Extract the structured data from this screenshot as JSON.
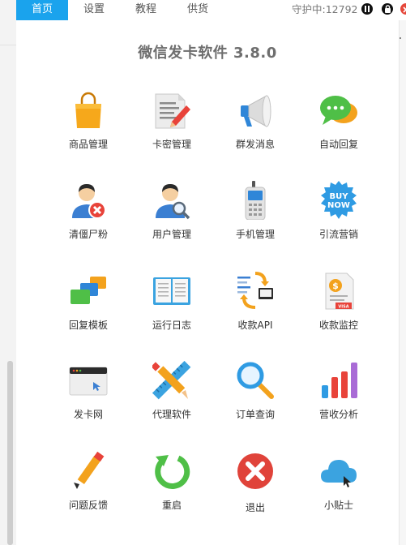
{
  "tabs": [
    {
      "label": "首页",
      "active": true
    },
    {
      "label": "设置",
      "active": false
    },
    {
      "label": "教程",
      "active": false
    },
    {
      "label": "供货",
      "active": false
    }
  ],
  "status_text": "守护中:12792",
  "title": "微信发卡软件 3.8.0",
  "colors": {
    "accent": "#1aa3ed",
    "close": "#e5473a"
  },
  "menu": [
    {
      "label": "商品管理",
      "icon": "shopping-bag-icon"
    },
    {
      "label": "卡密管理",
      "icon": "document-pen-icon"
    },
    {
      "label": "群发消息",
      "icon": "megaphone-icon"
    },
    {
      "label": "自动回复",
      "icon": "chat-bubble-icon"
    },
    {
      "label": "清僵尸粉",
      "icon": "remove-user-icon"
    },
    {
      "label": "用户管理",
      "icon": "user-search-icon"
    },
    {
      "label": "手机管理",
      "icon": "phone-icon"
    },
    {
      "label": "引流营销",
      "icon": "buy-now-badge-icon"
    },
    {
      "label": "回复模板",
      "icon": "template-cards-icon"
    },
    {
      "label": "运行日志",
      "icon": "open-book-icon"
    },
    {
      "label": "收款API",
      "icon": "api-sync-icon"
    },
    {
      "label": "收款监控",
      "icon": "invoice-icon"
    },
    {
      "label": "发卡网",
      "icon": "browser-window-icon"
    },
    {
      "label": "代理软件",
      "icon": "pencil-ruler-icon"
    },
    {
      "label": "订单查询",
      "icon": "magnifier-icon"
    },
    {
      "label": "营收分析",
      "icon": "bar-chart-icon"
    },
    {
      "label": "问题反馈",
      "icon": "pencil-icon"
    },
    {
      "label": "重启",
      "icon": "restart-icon"
    },
    {
      "label": "退出",
      "icon": "exit-icon"
    },
    {
      "label": "小贴士",
      "icon": "cloud-icon"
    }
  ]
}
